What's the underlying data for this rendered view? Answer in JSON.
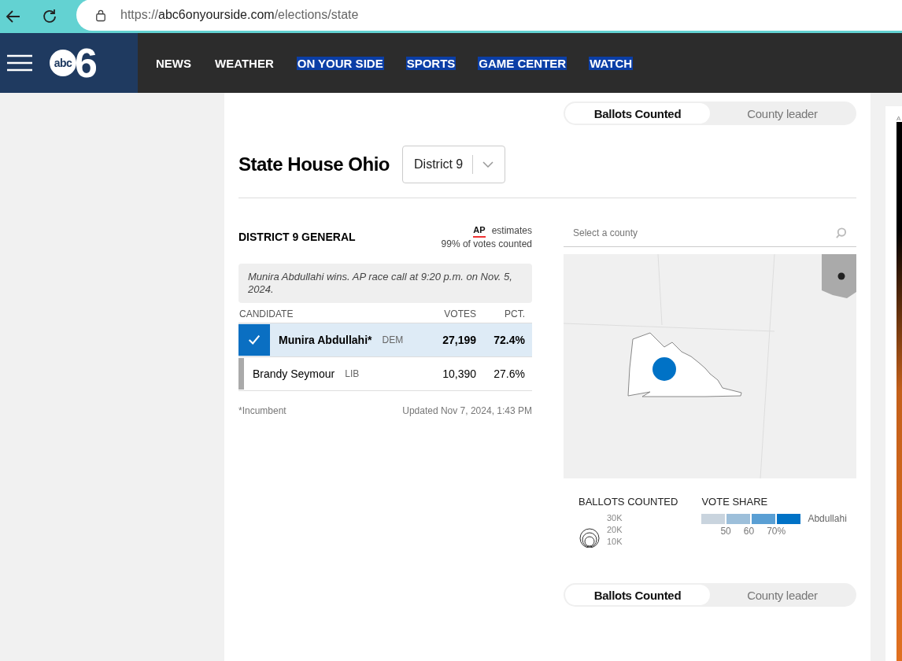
{
  "browser": {
    "url_host": "abc6onyourside.com",
    "url_path": "/elections/state",
    "url_scheme": "https://"
  },
  "logo": {
    "abc": "abc",
    "number": "6"
  },
  "nav": {
    "items": [
      {
        "label": "NEWS",
        "highlighted": false
      },
      {
        "label": "WEATHER",
        "highlighted": false
      },
      {
        "label": "ON YOUR SIDE",
        "highlighted": true
      },
      {
        "label": "SPORTS",
        "highlighted": true
      },
      {
        "label": "GAME CENTER",
        "highlighted": true
      },
      {
        "label": "WATCH",
        "highlighted": true
      }
    ]
  },
  "toggle_top": [
    {
      "label": "Ballots Counted",
      "selected": true
    },
    {
      "label": "County leader",
      "selected": false
    }
  ],
  "title": "State House Ohio",
  "district_select": {
    "value": "District 9"
  },
  "race": {
    "heading": "DISTRICT 9 GENERAL",
    "ap_logo": "AP",
    "estimates": "estimates",
    "counted": "99% of votes counted",
    "call_note": "Munira Abdullahi wins. AP race call at 9:20 p.m. on Nov. 5, 2024.",
    "columns": [
      "CANDIDATE",
      "VOTES",
      "PCT."
    ],
    "rows": [
      {
        "name": "Munira Abdullahi*",
        "party": "DEM",
        "votes": "27,199",
        "pct": "72.4%",
        "winner": true
      },
      {
        "name": "Brandy Seymour",
        "party": "LIB",
        "votes": "10,390",
        "pct": "27.6%",
        "winner": false
      }
    ],
    "footnote": "*Incumbent",
    "updated": "Updated Nov 7, 2024, 1:43 PM"
  },
  "county_search": {
    "placeholder": "Select a county"
  },
  "legend": {
    "ballots_title": "BALLOTS COUNTED",
    "ballots_ticks": [
      "30K",
      "20K",
      "10K"
    ],
    "share_title": "VOTE SHARE",
    "share_swatches": [
      {
        "color": "#c9d4de"
      },
      {
        "color": "#9dbfda"
      },
      {
        "color": "#5a9fd4"
      },
      {
        "color": "#0072c6"
      }
    ],
    "share_ticks": [
      "50",
      "60",
      "70%"
    ],
    "share_candidate": "Abdullahi"
  },
  "toggle_bottom": [
    {
      "label": "Ballots Counted",
      "selected": true
    },
    {
      "label": "County leader",
      "selected": false
    }
  ],
  "ad": {
    "label": "A"
  }
}
